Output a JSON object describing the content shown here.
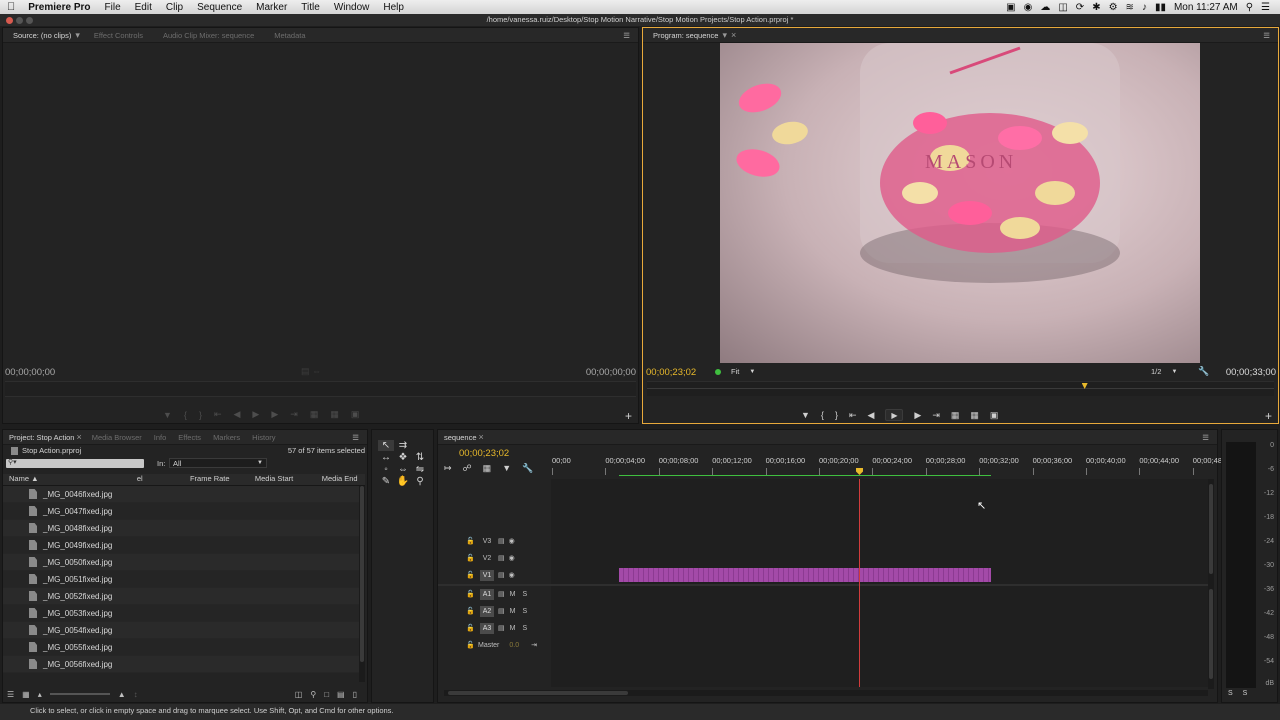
{
  "menubar": {
    "apple": "",
    "app_name": "Premiere Pro",
    "items": [
      "File",
      "Edit",
      "Clip",
      "Sequence",
      "Marker",
      "Title",
      "Window",
      "Help"
    ],
    "clock": "Mon 11:27 AM"
  },
  "window": {
    "title": "/home/vanessa.ruiz/Desktop/Stop Motion Narrative/Stop Motion Projects/Stop Action.prproj *"
  },
  "source_panel": {
    "tabs": [
      "Source: (no clips)",
      "Effect Controls",
      "Audio Clip Mixer: sequence",
      "Metadata"
    ],
    "timecode_in": "00;00;00;00",
    "timecode_out": "00;00;00;00"
  },
  "program_panel": {
    "tab": "Program: sequence",
    "timecode": "00;00;23;02",
    "fit": "Fit",
    "resolution": "1/2",
    "duration": "00;00;33;00",
    "playhead_progress": 0.7,
    "video_label": "MASON"
  },
  "project_panel": {
    "tabs": [
      "Project: Stop Action",
      "Media Browser",
      "Info",
      "Effects",
      "Markers",
      "History"
    ],
    "project_file": "Stop Action.prproj",
    "selection_count": "57 of 57 items selected",
    "in_label": "In:",
    "in_value": "All",
    "columns": [
      "Name",
      "el",
      "Frame Rate",
      "Media Start",
      "Media End"
    ],
    "files": [
      "_MG_0046fixed.jpg",
      "_MG_0047fixed.jpg",
      "_MG_0048fixed.jpg",
      "_MG_0049fixed.jpg",
      "_MG_0050fixed.jpg",
      "_MG_0051fixed.jpg",
      "_MG_0052fixed.jpg",
      "_MG_0053fixed.jpg",
      "_MG_0054fixed.jpg",
      "_MG_0055fixed.jpg",
      "_MG_0056fixed.jpg"
    ]
  },
  "timeline": {
    "tab": "sequence",
    "timecode": "00;00;23;02",
    "ruler": [
      "00;00",
      "00;00;04;00",
      "00;00;08;00",
      "00;00;12;00",
      "00;00;16;00",
      "00;00;20;00",
      "00;00;24;00",
      "00;00;28;00",
      "00;00;32;00",
      "00;00;36;00",
      "00;00;40;00",
      "00;00;44;00",
      "00;00;48;0"
    ],
    "video_tracks": [
      "V3",
      "V2",
      "V1"
    ],
    "audio_tracks": [
      "A1",
      "A2",
      "A3"
    ],
    "master_label": "Master",
    "master_value": "0.0",
    "mute": "M",
    "solo": "S"
  },
  "audio_meter": {
    "ticks": [
      "0",
      "-6",
      "-12",
      "-18",
      "-24",
      "-30",
      "-36",
      "-42",
      "-48",
      "-54"
    ],
    "unit": "dB",
    "solo_left": "S",
    "solo_right": "S"
  },
  "status_bar": {
    "text": "Click to select, or click in empty space and drag to marquee select. Use Shift, Opt, and Cmd for other options."
  },
  "colors": {
    "accent": "#e8a93b",
    "timecode": "#e8b92b",
    "clip": "#a34aa8",
    "playhead": "#d23c3c",
    "render_bar": "#3fbf3f"
  }
}
